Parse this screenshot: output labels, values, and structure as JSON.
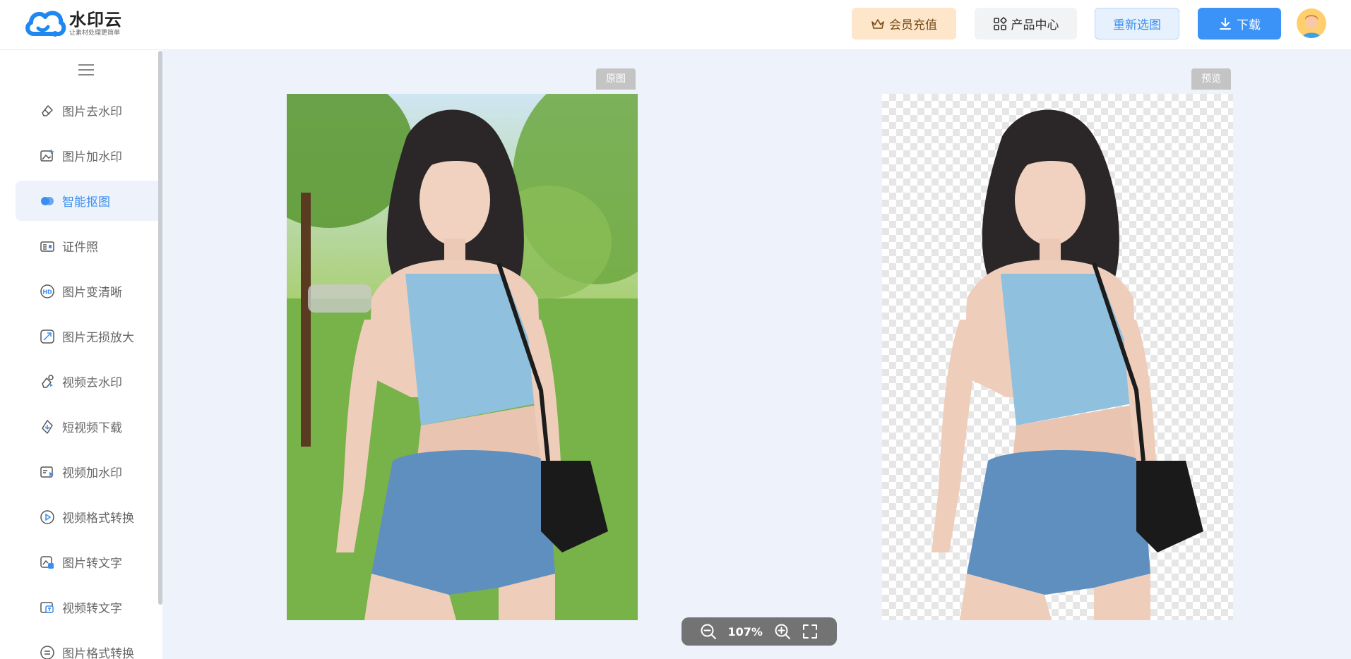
{
  "header": {
    "logo_title": "水印云",
    "logo_sub": "让素材处理更简单",
    "vip_label": "会员充值",
    "product_label": "产品中心",
    "reselect_label": "重新选图",
    "download_label": "下载"
  },
  "sidebar": {
    "items": [
      {
        "label": "图片去水印",
        "icon": "eraser-icon"
      },
      {
        "label": "图片加水印",
        "icon": "image-add-icon"
      },
      {
        "label": "智能抠图",
        "icon": "matting-icon",
        "active": true
      },
      {
        "label": "证件照",
        "icon": "id-card-icon"
      },
      {
        "label": "图片变清晰",
        "icon": "hd-icon"
      },
      {
        "label": "图片无损放大",
        "icon": "enlarge-icon"
      },
      {
        "label": "视频去水印",
        "icon": "video-eraser-icon"
      },
      {
        "label": "短视频下载",
        "icon": "video-download-icon"
      },
      {
        "label": "视频加水印",
        "icon": "video-watermark-icon"
      },
      {
        "label": "视频格式转换",
        "icon": "video-convert-icon"
      },
      {
        "label": "图片转文字",
        "icon": "image-to-text-icon"
      },
      {
        "label": "视频转文字",
        "icon": "video-to-text-icon"
      },
      {
        "label": "图片格式转换",
        "icon": "image-format-icon"
      }
    ]
  },
  "main": {
    "original_label": "原图",
    "preview_label": "预览",
    "zoom": "107%"
  },
  "colors": {
    "accent": "#3b8ef0",
    "vip_bg": "#fde6c9",
    "zoombar_bg": "#737373"
  }
}
